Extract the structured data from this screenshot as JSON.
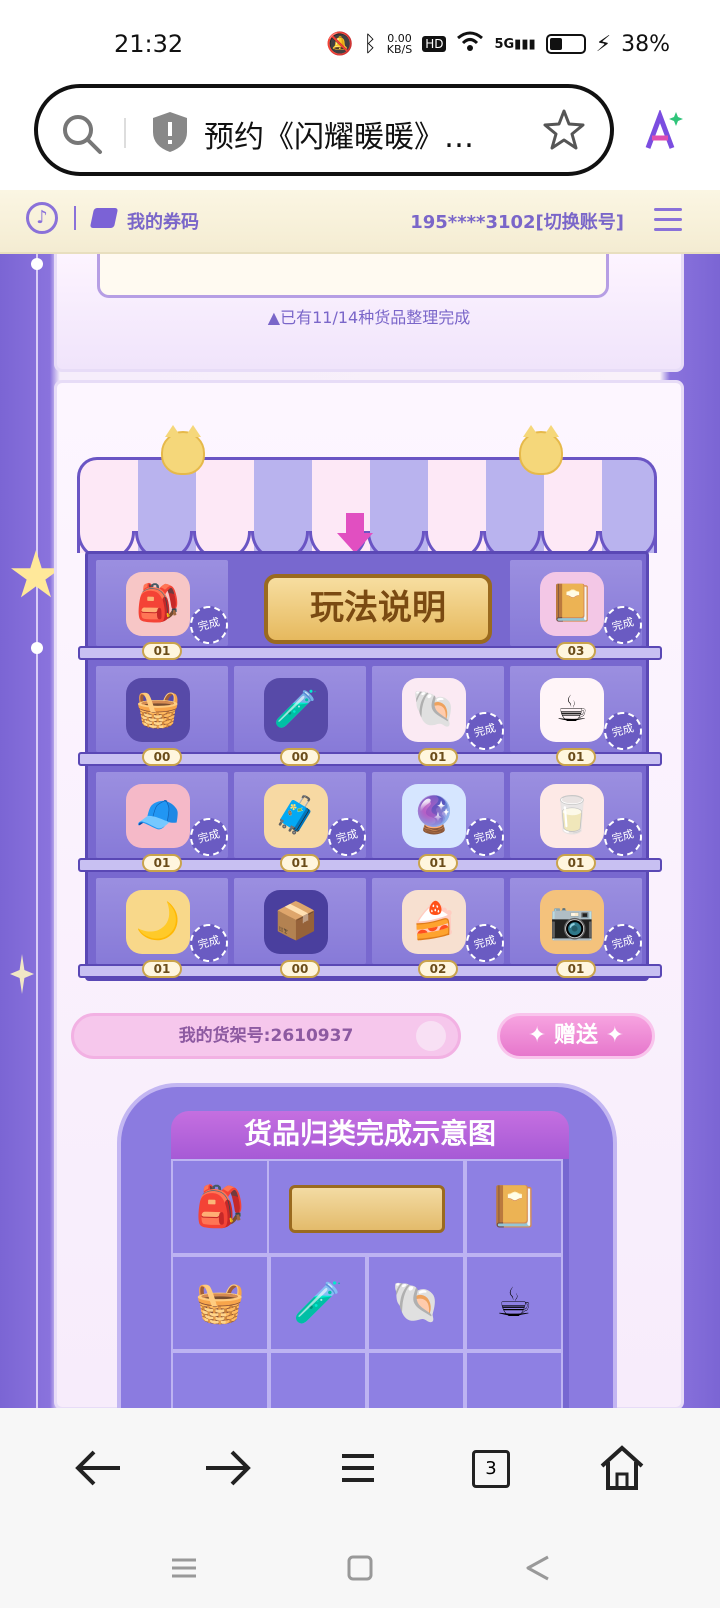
{
  "status": {
    "time": "21:32",
    "net_speed": "0.00",
    "net_unit": "KB/S",
    "hd": "HD",
    "network": "5G",
    "battery_level": 0.38,
    "battery": "38%"
  },
  "browser": {
    "tab_title": "预约《闪耀暖暖》…",
    "tab_count": "3"
  },
  "subheader": {
    "coupons": "我的券码",
    "account": "195****3102[切换账号]"
  },
  "progress": {
    "text": "▲已有11/14种货品整理完成"
  },
  "howto": "玩法说明",
  "shelf": {
    "complete_label": "完成",
    "rows": [
      [
        {
          "icon": "🎒",
          "count": "01",
          "done": true
        },
        {
          "icon": "",
          "count": "",
          "done": false,
          "howto": true
        },
        {
          "icon": "📔",
          "count": "03",
          "done": true
        }
      ],
      [
        {
          "icon": "🧺",
          "count": "00",
          "done": false
        },
        {
          "icon": "🧪",
          "count": "00",
          "done": false
        },
        {
          "icon": "🐚",
          "count": "01",
          "done": true
        },
        {
          "icon": "☕",
          "count": "01",
          "done": true
        }
      ],
      [
        {
          "icon": "🧢",
          "count": "01",
          "done": true
        },
        {
          "icon": "🧳",
          "count": "01",
          "done": true
        },
        {
          "icon": "🔮",
          "count": "01",
          "done": true
        },
        {
          "icon": "🥛",
          "count": "01",
          "done": true
        }
      ],
      [
        {
          "icon": "🌙",
          "count": "01",
          "done": true
        },
        {
          "icon": "📦",
          "count": "00",
          "done": false
        },
        {
          "icon": "🍰",
          "count": "02",
          "done": true
        },
        {
          "icon": "📷",
          "count": "01",
          "done": true
        }
      ]
    ]
  },
  "shelf_number": "我的货架号:2610937",
  "gift_button": "✦ 赠送 ✦",
  "demo_title": "货品归类完成示意图",
  "demo_items": [
    "🎒",
    "📔",
    "🧺",
    "🧪",
    "🐚",
    "☕"
  ]
}
